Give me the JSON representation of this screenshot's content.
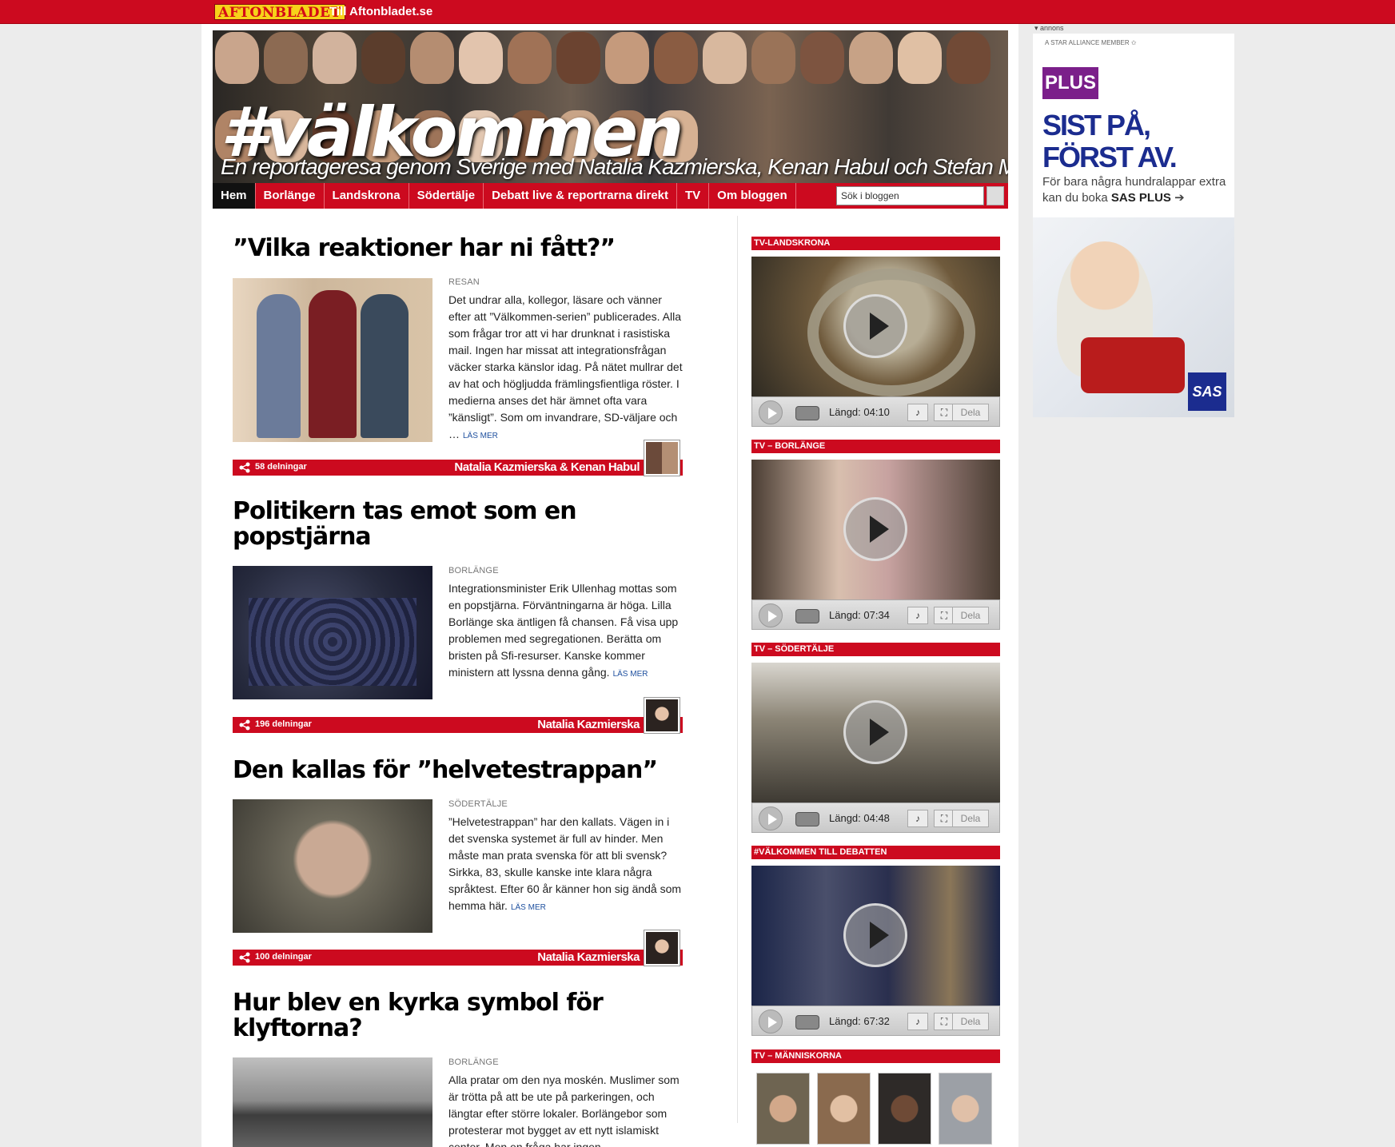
{
  "topbar": {
    "logo": "AFTONBLADET",
    "link": "Till Aftonbladet.se",
    "accent": "#cc0a1f"
  },
  "banner": {
    "title": "#välkommen",
    "subtitle": "En reportageresa genom Sverige med Natalia Kazmierska, Kenan Habul och Stefan Mattsson"
  },
  "nav": {
    "items": [
      "Hem",
      "Borlänge",
      "Landskrona",
      "Södertälje",
      "Debatt live & reportrarna direkt",
      "TV",
      "Om bloggen"
    ],
    "active": "Hem",
    "search_placeholder": "Sök i bloggen"
  },
  "articles": [
    {
      "title": "”Vilka reaktioner har ni fått?”",
      "category": "RESAN",
      "excerpt": "Det undrar alla, kollegor, läsare och vänner efter att ”Välkommen-serien” publicerades. Alla som frågar tror att vi har drunknat i rasistiska mail. Ingen har missat att integrationsfrågan väcker starka känslor idag. På nätet mullrar det av hat och högljudda främlingsfientliga röster. I medierna anses det här ämnet ofta vara ”känsligt”. Som om invandrare, SD-väljare och …",
      "more": "LÄS MER",
      "shares": "58 delningar",
      "author": "Natalia Kazmierska & Kenan Habul"
    },
    {
      "title": "Politikern tas emot som en popstjärna",
      "category": "BORLÄNGE",
      "excerpt": "Integrationsminister Erik Ullenhag mottas som en popstjärna. Förväntningarna är höga. Lilla Borlänge ska äntligen få chansen. Få visa upp problemen med segregationen. Berätta om bristen på Sfi-resurser. Kanske kommer ministern att lyssna denna gång.",
      "more": "LÄS MER",
      "shares": "196 delningar",
      "author": "Natalia Kazmierska"
    },
    {
      "title": "Den kallas för ”helvetestrappan”",
      "category": "SÖDERTÄLJE",
      "excerpt": "”Helvetestrappan” har den kallats. Vägen in i det svenska systemet är full av hinder. Men måste man prata svenska för att bli svensk? Sirkka, 83, skulle kanske inte klara några språktest. Efter 60 år känner hon sig ändå som hemma här.",
      "more": "LÄS MER",
      "shares": "100 delningar",
      "author": "Natalia Kazmierska"
    },
    {
      "title": "Hur blev en kyrka symbol för klyftorna?",
      "category": "BORLÄNGE",
      "excerpt": "Alla pratar om den nya moskén. Muslimer som är trötta på att be ute på parkeringen, och längtar efter större lokaler. Borlängebor som protesterar mot bygget av ett nytt islamiskt center. Men en fråga har ingen",
      "more": "",
      "shares": "",
      "author": ""
    }
  ],
  "videos": [
    {
      "label": "TV-LANDSKRONA",
      "length": "Längd: 04:10",
      "share": "Dela"
    },
    {
      "label": "TV – BORLÄNGE",
      "length": "Längd: 07:34",
      "share": "Dela"
    },
    {
      "label": "TV – SÖDERTÄLJE",
      "length": "Längd: 04:48",
      "share": "Dela"
    },
    {
      "label": "#VÄLKOMMEN TILL DEBATTEN",
      "length": "Längd: 67:32",
      "share": "Dela"
    }
  ],
  "people": {
    "label": "TV – MÄNNISKORNA"
  },
  "ad": {
    "label": "annons",
    "star": "A STAR ALLIANCE MEMBER",
    "plus": "PLUS",
    "headline1": "SIST PÅ,",
    "headline2": "FÖRST AV.",
    "text_prefix": "För bara några hundralappar extra kan du boka ",
    "text_bold": "SAS PLUS",
    "brand": "SAS"
  }
}
